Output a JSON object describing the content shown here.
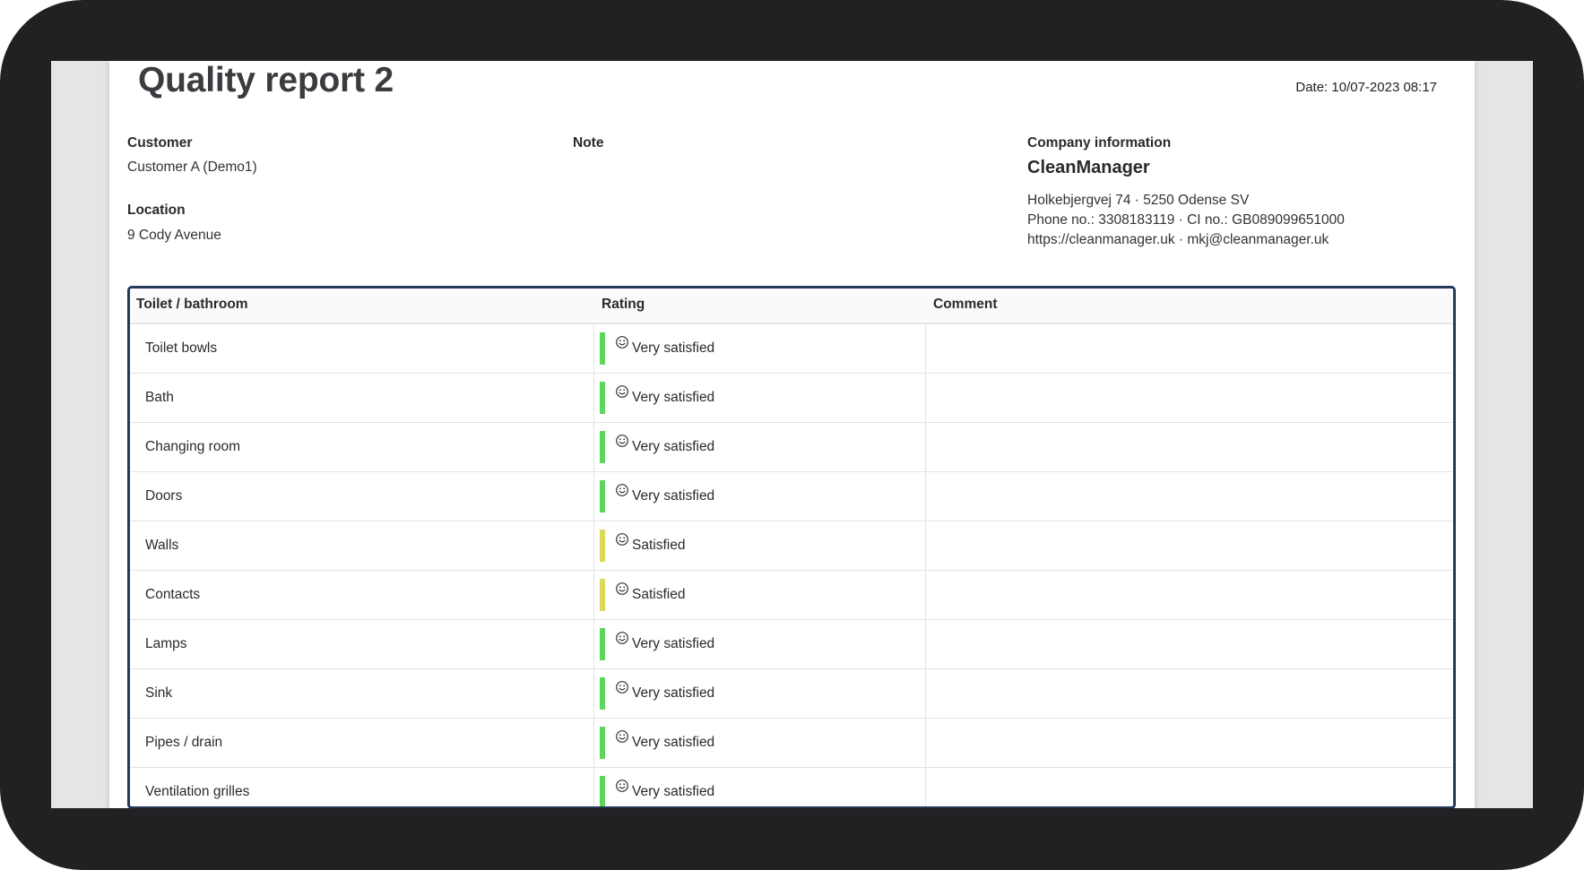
{
  "report": {
    "title": "Quality report 2",
    "date": "Date: 10/07-2023 08:17"
  },
  "customer": {
    "label": "Customer",
    "value": "Customer A (Demo1)"
  },
  "location": {
    "label": "Location",
    "value": "9 Cody Avenue"
  },
  "note": {
    "label": "Note"
  },
  "company": {
    "label": "Company information",
    "name": "CleanManager",
    "address": "Holkebjergvej 74 · 5250 Odense SV",
    "phone": "Phone no.: 3308183119 · CI no.: GB089099651000",
    "web": "https://cleanmanager.uk · mkj@cleanmanager.uk"
  },
  "table": {
    "headers": [
      "Toilet / bathroom",
      "Rating",
      "Comment"
    ],
    "rows": [
      {
        "item": "Toilet bowls",
        "rating": "Very satisfied",
        "comment": "",
        "color": "#5cd65c",
        "icon": "smiley-icon"
      },
      {
        "item": "Bath",
        "rating": "Very satisfied",
        "comment": "",
        "color": "#5cd65c",
        "icon": "smiley-icon"
      },
      {
        "item": "Changing room",
        "rating": "Very satisfied",
        "comment": "",
        "color": "#5cd65c",
        "icon": "smiley-icon"
      },
      {
        "item": "Doors",
        "rating": "Very satisfied",
        "comment": "",
        "color": "#5cd65c",
        "icon": "smiley-icon"
      },
      {
        "item": "Walls",
        "rating": "Satisfied",
        "comment": "",
        "color": "#dcd85a",
        "icon": "smiley-icon"
      },
      {
        "item": "Contacts",
        "rating": "Satisfied",
        "comment": "",
        "color": "#dcd85a",
        "icon": "smiley-icon"
      },
      {
        "item": "Lamps",
        "rating": "Very satisfied",
        "comment": "",
        "color": "#5cd65c",
        "icon": "smiley-icon"
      },
      {
        "item": "Sink",
        "rating": "Very satisfied",
        "comment": "",
        "color": "#5cd65c",
        "icon": "smiley-icon"
      },
      {
        "item": "Pipes / drain",
        "rating": "Very satisfied",
        "comment": "",
        "color": "#5cd65c",
        "icon": "smiley-icon"
      },
      {
        "item": "Ventilation grilles",
        "rating": "Very satisfied",
        "comment": "",
        "color": "#5cd65c",
        "icon": "smiley-icon"
      }
    ]
  },
  "colors": {
    "table_border": "#26385a",
    "very_satisfied": "#5cd65c",
    "satisfied": "#dcd85a"
  }
}
